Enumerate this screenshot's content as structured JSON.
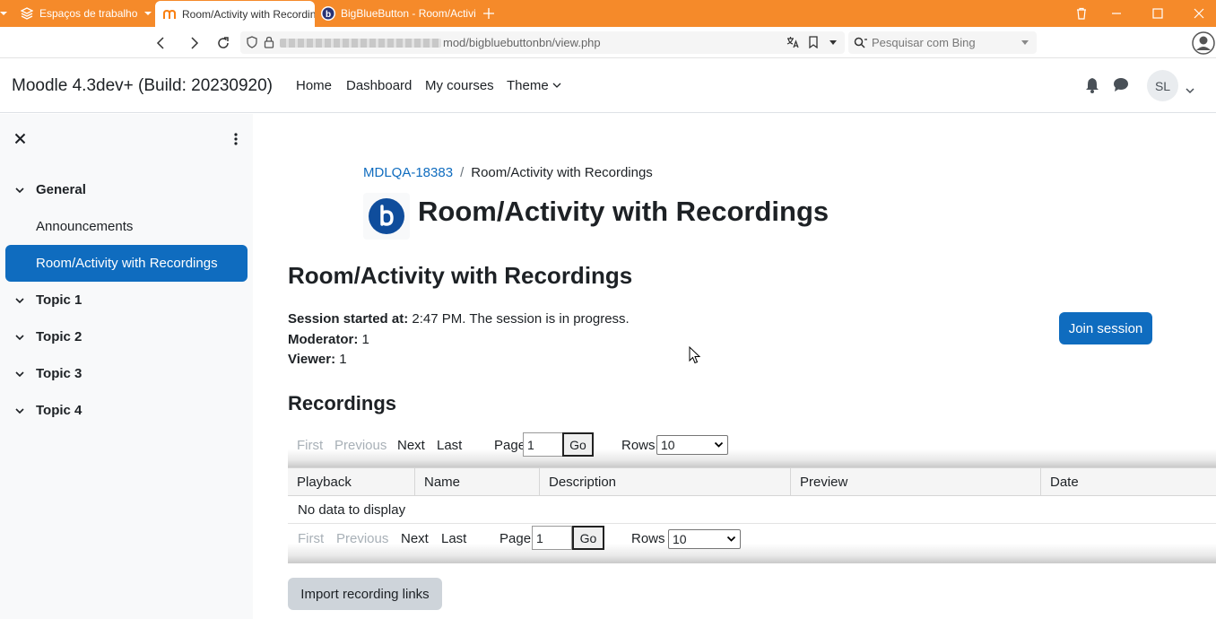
{
  "browser": {
    "tabs": [
      {
        "label": "Espaços de trabalho",
        "icon": "workspaces-icon"
      },
      {
        "label": "Room/Activity with Recordings",
        "icon": "moodle-favicon",
        "active": true
      },
      {
        "label": "BigBlueButton - Room/Activi",
        "icon": "bigbluebutton-favicon"
      }
    ],
    "url_path": "mod/bigbluebuttonbn/view.php",
    "search_placeholder": "Pesquisar com Bing"
  },
  "navbar": {
    "brand": "Moodle 4.3dev+ (Build: 20230920)",
    "links": [
      "Home",
      "Dashboard",
      "My courses",
      "Theme"
    ],
    "avatar_initials": "SL"
  },
  "drawer": {
    "sections": [
      {
        "label": "General",
        "activities": [
          {
            "label": "Announcements",
            "current": false
          },
          {
            "label": "Room/Activity with Recordings",
            "current": true
          }
        ]
      },
      {
        "label": "Topic 1"
      },
      {
        "label": "Topic 2"
      },
      {
        "label": "Topic 3"
      },
      {
        "label": "Topic 4"
      }
    ]
  },
  "breadcrumb": {
    "course": "MDLQA-18383",
    "separator": "/",
    "current": "Room/Activity with Recordings"
  },
  "page_title": "Room/Activity with Recordings",
  "room": {
    "heading": "Room/Activity with Recordings",
    "session_label": "Session started at:",
    "session_value": "2:47 PM. The session is in progress.",
    "moderator_label": "Moderator:",
    "moderator_value": "1",
    "viewer_label": "Viewer:",
    "viewer_value": "1",
    "join_label": "Join session"
  },
  "recordings": {
    "heading": "Recordings",
    "pager": {
      "first": "First",
      "previous": "Previous",
      "next": "Next",
      "last": "Last",
      "page_label": "Page",
      "page_value": "1",
      "go": "Go",
      "rows_label": "Rows",
      "rows_value": "10"
    },
    "columns": [
      "Playback",
      "Name",
      "Description",
      "Preview",
      "Date"
    ],
    "empty": "No data to display",
    "import_label": "Import recording links"
  },
  "colors": {
    "accent": "#0f6cbf",
    "browser_chrome": "#f58a2a",
    "drawer_bg": "#f8f9fa"
  }
}
